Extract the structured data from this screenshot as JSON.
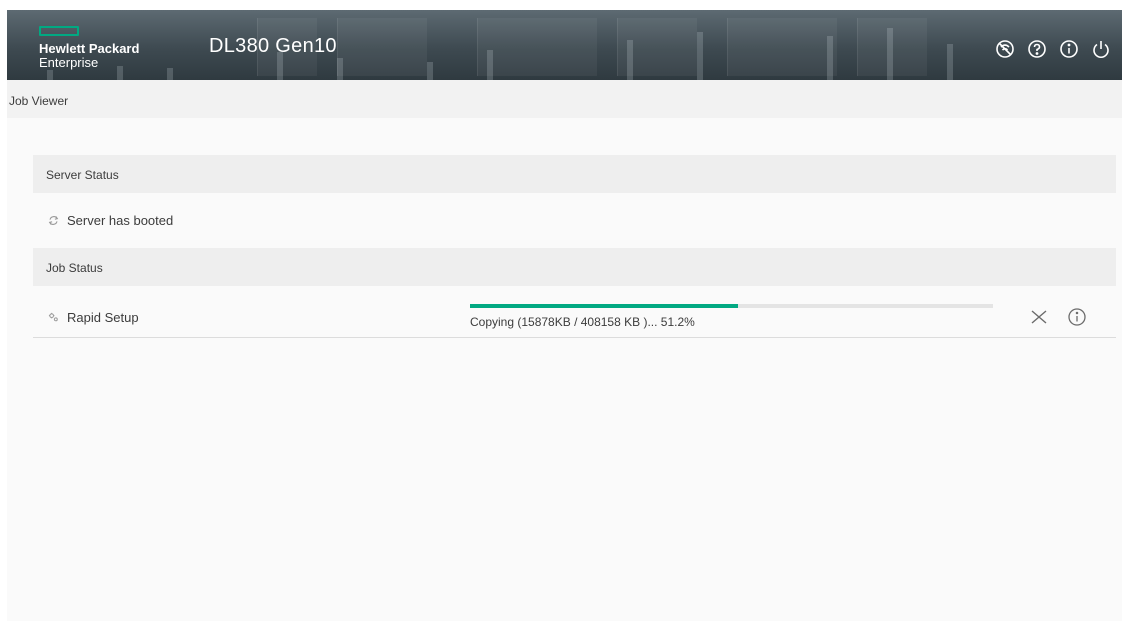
{
  "header": {
    "brand_line1": "Hewlett Packard",
    "brand_line2": "Enterprise",
    "product": "DL380 Gen10",
    "icons": [
      "no-network-icon",
      "help-icon",
      "info-icon",
      "power-icon"
    ]
  },
  "subbar": {
    "title": "Job Viewer"
  },
  "server_status": {
    "heading": "Server Status",
    "message": "Server has booted",
    "icon": "refresh-icon"
  },
  "job_status": {
    "heading": "Job Status",
    "job_name": "Rapid Setup",
    "job_icon": "setup-icon",
    "progress_text": "Copying (15878KB / 408158 KB )... 51.2%",
    "progress_percent": 51.2,
    "actions": [
      "cancel-icon",
      "info-icon"
    ]
  },
  "colors": {
    "accent": "#01a982",
    "header_bg": "#3e4a51",
    "section_bg": "#eeeeee",
    "content_bg": "#fafafa"
  }
}
